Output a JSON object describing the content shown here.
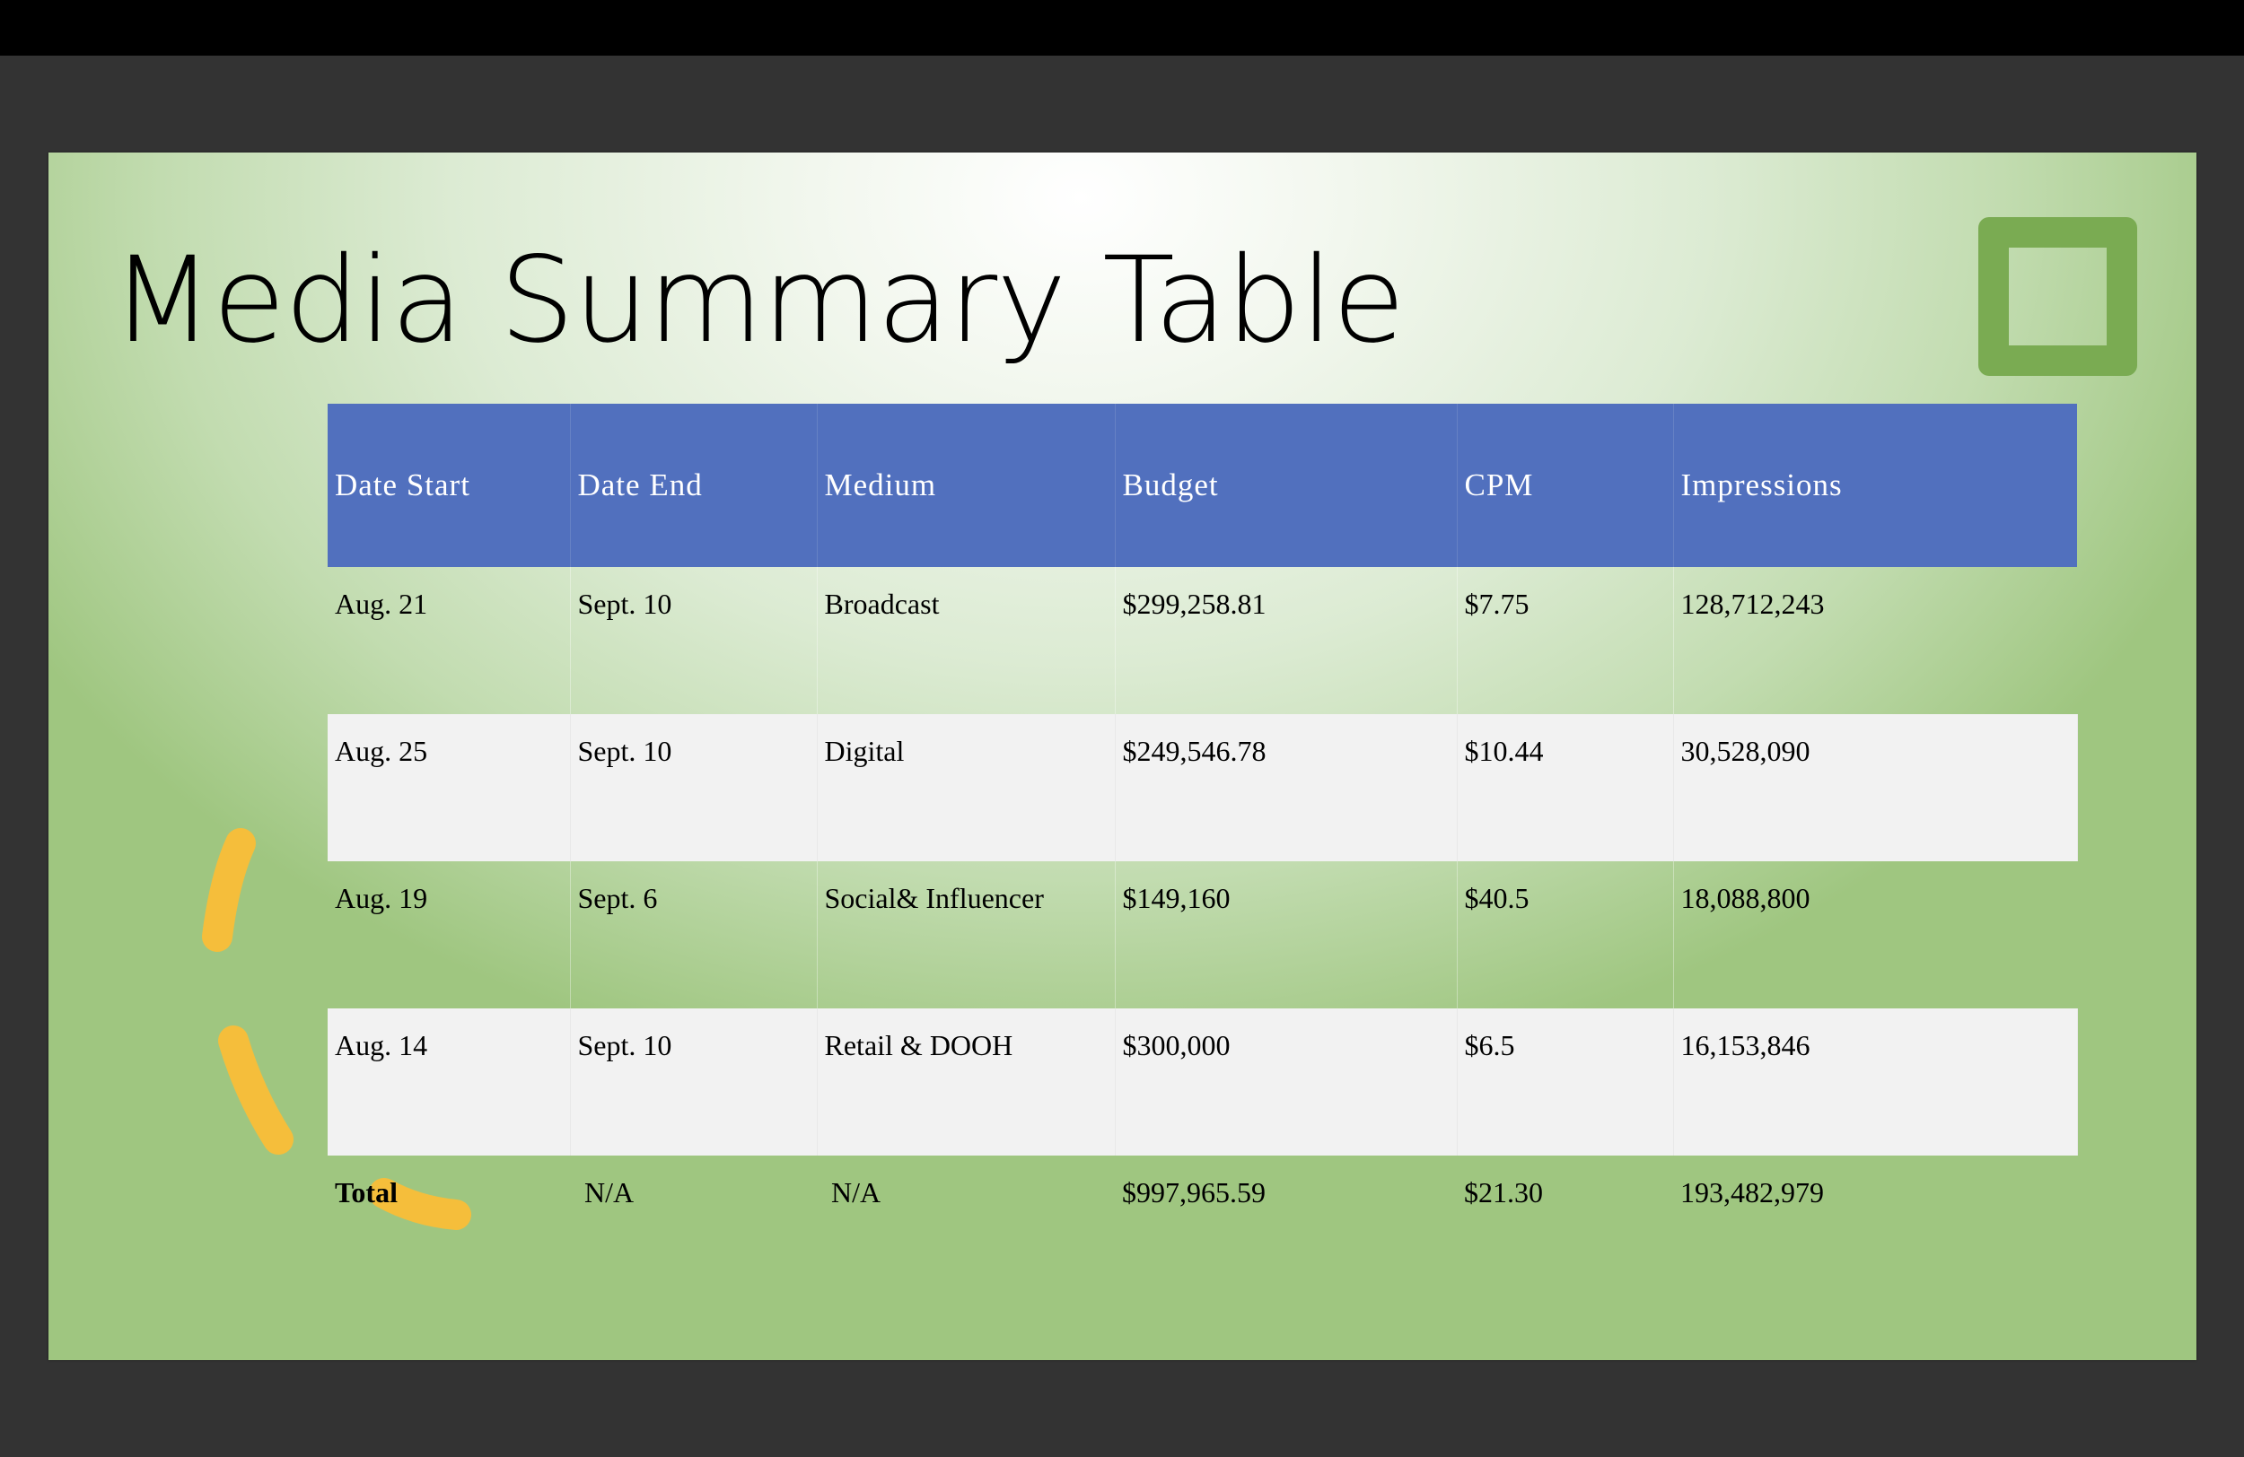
{
  "slide": {
    "title": "Media Summary Table",
    "colors": {
      "header_fill": "#5170be",
      "shaded_row": "#f2f2f2",
      "deco_square": "#7aab52",
      "deco_arc": "#f5be3b"
    }
  },
  "table": {
    "headers": [
      "Date Start",
      "Date End",
      "Medium",
      "Budget",
      "CPM",
      "Impressions"
    ],
    "rows": [
      [
        "Aug. 21",
        "Sept. 10",
        "Broadcast",
        "$299,258.81",
        "$7.75",
        "128,712,243"
      ],
      [
        "Aug. 25",
        "Sept. 10",
        "Digital",
        "$249,546.78",
        "$10.44",
        "30,528,090"
      ],
      [
        "Aug. 19",
        "Sept. 6",
        "Social& Influencer",
        "$149,160",
        "$40.5",
        "18,088,800"
      ],
      [
        "Aug. 14",
        "Sept. 10",
        "Retail & DOOH",
        "$300,000",
        "$6.5",
        "16,153,846"
      ]
    ],
    "total": [
      "Total",
      "N/A",
      "N/A",
      "$997,965.59",
      "$21.30",
      "193,482,979"
    ]
  }
}
